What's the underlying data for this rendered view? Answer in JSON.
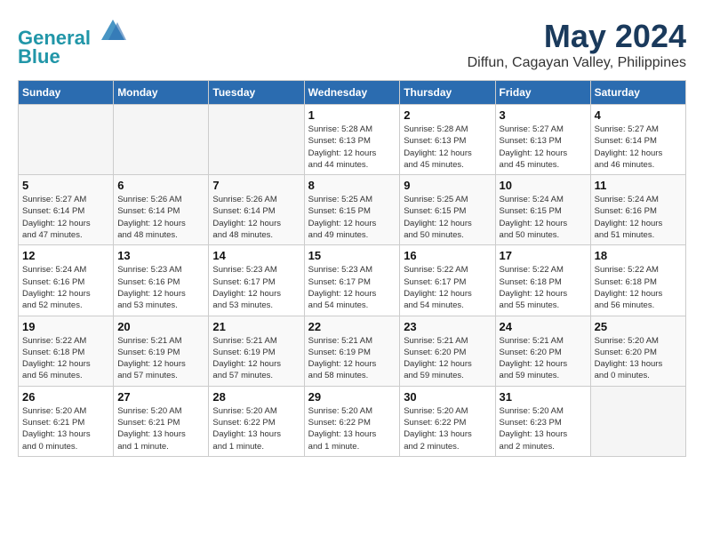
{
  "header": {
    "logo_line1": "General",
    "logo_line2": "Blue",
    "month": "May 2024",
    "location": "Diffun, Cagayan Valley, Philippines"
  },
  "weekdays": [
    "Sunday",
    "Monday",
    "Tuesday",
    "Wednesday",
    "Thursday",
    "Friday",
    "Saturday"
  ],
  "weeks": [
    [
      {
        "day": "",
        "info": ""
      },
      {
        "day": "",
        "info": ""
      },
      {
        "day": "",
        "info": ""
      },
      {
        "day": "1",
        "info": "Sunrise: 5:28 AM\nSunset: 6:13 PM\nDaylight: 12 hours\nand 44 minutes."
      },
      {
        "day": "2",
        "info": "Sunrise: 5:28 AM\nSunset: 6:13 PM\nDaylight: 12 hours\nand 45 minutes."
      },
      {
        "day": "3",
        "info": "Sunrise: 5:27 AM\nSunset: 6:13 PM\nDaylight: 12 hours\nand 45 minutes."
      },
      {
        "day": "4",
        "info": "Sunrise: 5:27 AM\nSunset: 6:14 PM\nDaylight: 12 hours\nand 46 minutes."
      }
    ],
    [
      {
        "day": "5",
        "info": "Sunrise: 5:27 AM\nSunset: 6:14 PM\nDaylight: 12 hours\nand 47 minutes."
      },
      {
        "day": "6",
        "info": "Sunrise: 5:26 AM\nSunset: 6:14 PM\nDaylight: 12 hours\nand 48 minutes."
      },
      {
        "day": "7",
        "info": "Sunrise: 5:26 AM\nSunset: 6:14 PM\nDaylight: 12 hours\nand 48 minutes."
      },
      {
        "day": "8",
        "info": "Sunrise: 5:25 AM\nSunset: 6:15 PM\nDaylight: 12 hours\nand 49 minutes."
      },
      {
        "day": "9",
        "info": "Sunrise: 5:25 AM\nSunset: 6:15 PM\nDaylight: 12 hours\nand 50 minutes."
      },
      {
        "day": "10",
        "info": "Sunrise: 5:24 AM\nSunset: 6:15 PM\nDaylight: 12 hours\nand 50 minutes."
      },
      {
        "day": "11",
        "info": "Sunrise: 5:24 AM\nSunset: 6:16 PM\nDaylight: 12 hours\nand 51 minutes."
      }
    ],
    [
      {
        "day": "12",
        "info": "Sunrise: 5:24 AM\nSunset: 6:16 PM\nDaylight: 12 hours\nand 52 minutes."
      },
      {
        "day": "13",
        "info": "Sunrise: 5:23 AM\nSunset: 6:16 PM\nDaylight: 12 hours\nand 53 minutes."
      },
      {
        "day": "14",
        "info": "Sunrise: 5:23 AM\nSunset: 6:17 PM\nDaylight: 12 hours\nand 53 minutes."
      },
      {
        "day": "15",
        "info": "Sunrise: 5:23 AM\nSunset: 6:17 PM\nDaylight: 12 hours\nand 54 minutes."
      },
      {
        "day": "16",
        "info": "Sunrise: 5:22 AM\nSunset: 6:17 PM\nDaylight: 12 hours\nand 54 minutes."
      },
      {
        "day": "17",
        "info": "Sunrise: 5:22 AM\nSunset: 6:18 PM\nDaylight: 12 hours\nand 55 minutes."
      },
      {
        "day": "18",
        "info": "Sunrise: 5:22 AM\nSunset: 6:18 PM\nDaylight: 12 hours\nand 56 minutes."
      }
    ],
    [
      {
        "day": "19",
        "info": "Sunrise: 5:22 AM\nSunset: 6:18 PM\nDaylight: 12 hours\nand 56 minutes."
      },
      {
        "day": "20",
        "info": "Sunrise: 5:21 AM\nSunset: 6:19 PM\nDaylight: 12 hours\nand 57 minutes."
      },
      {
        "day": "21",
        "info": "Sunrise: 5:21 AM\nSunset: 6:19 PM\nDaylight: 12 hours\nand 57 minutes."
      },
      {
        "day": "22",
        "info": "Sunrise: 5:21 AM\nSunset: 6:19 PM\nDaylight: 12 hours\nand 58 minutes."
      },
      {
        "day": "23",
        "info": "Sunrise: 5:21 AM\nSunset: 6:20 PM\nDaylight: 12 hours\nand 59 minutes."
      },
      {
        "day": "24",
        "info": "Sunrise: 5:21 AM\nSunset: 6:20 PM\nDaylight: 12 hours\nand 59 minutes."
      },
      {
        "day": "25",
        "info": "Sunrise: 5:20 AM\nSunset: 6:20 PM\nDaylight: 13 hours\nand 0 minutes."
      }
    ],
    [
      {
        "day": "26",
        "info": "Sunrise: 5:20 AM\nSunset: 6:21 PM\nDaylight: 13 hours\nand 0 minutes."
      },
      {
        "day": "27",
        "info": "Sunrise: 5:20 AM\nSunset: 6:21 PM\nDaylight: 13 hours\nand 1 minute."
      },
      {
        "day": "28",
        "info": "Sunrise: 5:20 AM\nSunset: 6:22 PM\nDaylight: 13 hours\nand 1 minute."
      },
      {
        "day": "29",
        "info": "Sunrise: 5:20 AM\nSunset: 6:22 PM\nDaylight: 13 hours\nand 1 minute."
      },
      {
        "day": "30",
        "info": "Sunrise: 5:20 AM\nSunset: 6:22 PM\nDaylight: 13 hours\nand 2 minutes."
      },
      {
        "day": "31",
        "info": "Sunrise: 5:20 AM\nSunset: 6:23 PM\nDaylight: 13 hours\nand 2 minutes."
      },
      {
        "day": "",
        "info": ""
      }
    ]
  ]
}
